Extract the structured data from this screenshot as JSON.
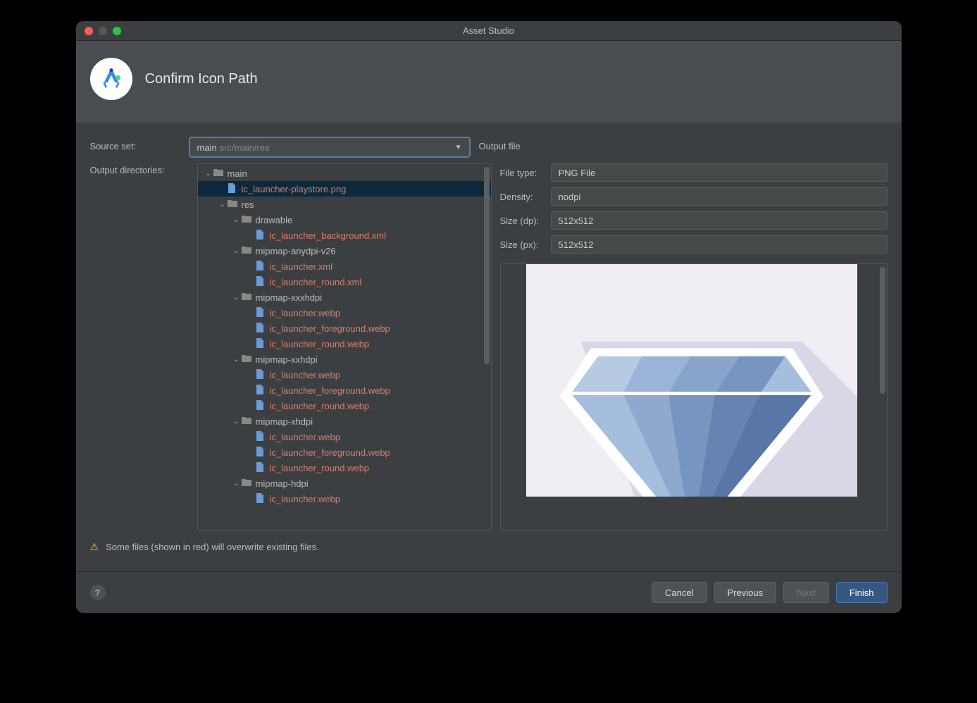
{
  "window": {
    "title": "Asset Studio"
  },
  "header": {
    "title": "Confirm Icon Path"
  },
  "form": {
    "source_set_label": "Source set:",
    "source_set_value": "main",
    "source_set_path": "src/main/res",
    "output_dirs_label": "Output directories:"
  },
  "tree": [
    {
      "depth": 0,
      "expanded": true,
      "type": "folder",
      "name": "main",
      "conflict": false
    },
    {
      "depth": 1,
      "expanded": null,
      "type": "file",
      "name": "ic_launcher-playstore.png",
      "conflict": true,
      "selected": true
    },
    {
      "depth": 1,
      "expanded": true,
      "type": "folder",
      "name": "res",
      "conflict": false
    },
    {
      "depth": 2,
      "expanded": true,
      "type": "folder",
      "name": "drawable",
      "conflict": false
    },
    {
      "depth": 3,
      "expanded": null,
      "type": "file",
      "name": "ic_launcher_background.xml",
      "conflict": true
    },
    {
      "depth": 2,
      "expanded": true,
      "type": "folder",
      "name": "mipmap-anydpi-v26",
      "conflict": false
    },
    {
      "depth": 3,
      "expanded": null,
      "type": "file",
      "name": "ic_launcher.xml",
      "conflict": true
    },
    {
      "depth": 3,
      "expanded": null,
      "type": "file",
      "name": "ic_launcher_round.xml",
      "conflict": true
    },
    {
      "depth": 2,
      "expanded": true,
      "type": "folder",
      "name": "mipmap-xxxhdpi",
      "conflict": false
    },
    {
      "depth": 3,
      "expanded": null,
      "type": "file",
      "name": "ic_launcher.webp",
      "conflict": true
    },
    {
      "depth": 3,
      "expanded": null,
      "type": "file",
      "name": "ic_launcher_foreground.webp",
      "conflict": true
    },
    {
      "depth": 3,
      "expanded": null,
      "type": "file",
      "name": "ic_launcher_round.webp",
      "conflict": true
    },
    {
      "depth": 2,
      "expanded": true,
      "type": "folder",
      "name": "mipmap-xxhdpi",
      "conflict": false
    },
    {
      "depth": 3,
      "expanded": null,
      "type": "file",
      "name": "ic_launcher.webp",
      "conflict": true
    },
    {
      "depth": 3,
      "expanded": null,
      "type": "file",
      "name": "ic_launcher_foreground.webp",
      "conflict": true
    },
    {
      "depth": 3,
      "expanded": null,
      "type": "file",
      "name": "ic_launcher_round.webp",
      "conflict": true
    },
    {
      "depth": 2,
      "expanded": true,
      "type": "folder",
      "name": "mipmap-xhdpi",
      "conflict": false
    },
    {
      "depth": 3,
      "expanded": null,
      "type": "file",
      "name": "ic_launcher.webp",
      "conflict": true
    },
    {
      "depth": 3,
      "expanded": null,
      "type": "file",
      "name": "ic_launcher_foreground.webp",
      "conflict": true
    },
    {
      "depth": 3,
      "expanded": null,
      "type": "file",
      "name": "ic_launcher_round.webp",
      "conflict": true
    },
    {
      "depth": 2,
      "expanded": true,
      "type": "folder",
      "name": "mipmap-hdpi",
      "conflict": false
    },
    {
      "depth": 3,
      "expanded": null,
      "type": "file",
      "name": "ic_launcher.webp",
      "conflict": true
    }
  ],
  "output_file": {
    "section_label": "Output file",
    "file_type_label": "File type:",
    "file_type_value": "PNG File",
    "density_label": "Density:",
    "density_value": "nodpi",
    "size_dp_label": "Size (dp):",
    "size_dp_value": "512x512",
    "size_px_label": "Size (px):",
    "size_px_value": "512x512"
  },
  "warning": {
    "text": "Some files (shown in red) will overwrite existing files."
  },
  "buttons": {
    "cancel": "Cancel",
    "previous": "Previous",
    "next": "Next",
    "finish": "Finish"
  }
}
